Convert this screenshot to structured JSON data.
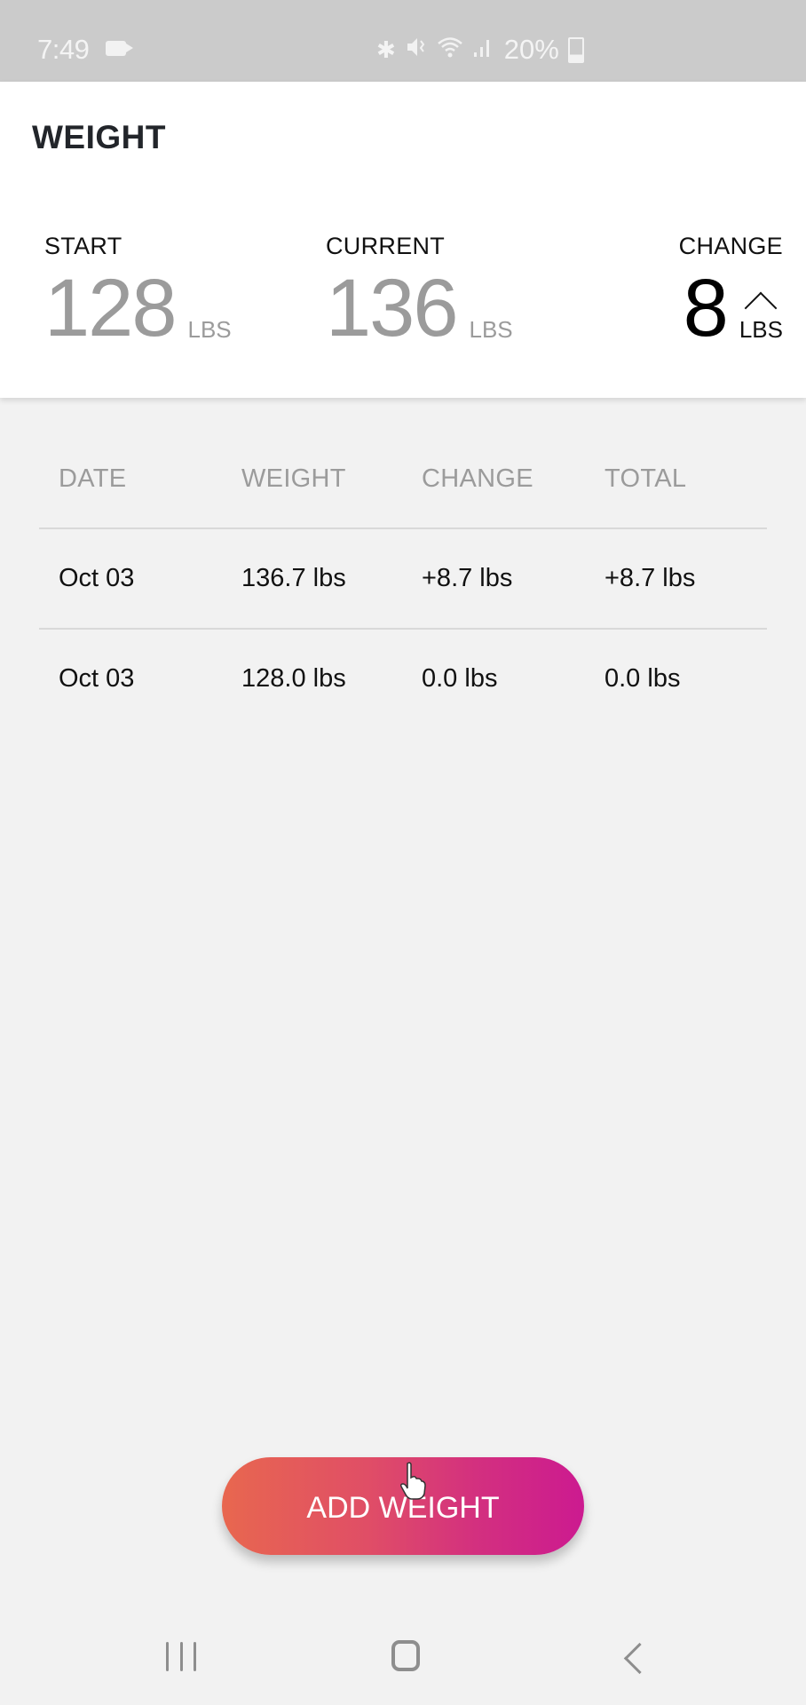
{
  "status_bar": {
    "time": "7:49",
    "battery_percent": "20%",
    "icons": [
      "video-record-icon",
      "bluetooth-icon",
      "mute-icon",
      "wifi-icon",
      "signal-icon",
      "battery-icon"
    ],
    "glyphs": {
      "bluetooth": "✱",
      "mute": "🔇︎",
      "wifi": "≋",
      "signal": ".ıl"
    }
  },
  "summary": {
    "title": "WEIGHT",
    "start": {
      "label": "START",
      "value": "128",
      "unit": "LBS"
    },
    "current": {
      "label": "CURRENT",
      "value": "136",
      "unit": "LBS"
    },
    "change": {
      "label": "CHANGE",
      "value": "8",
      "unit": "LBS",
      "direction": "up"
    }
  },
  "table": {
    "headers": [
      "DATE",
      "WEIGHT",
      "CHANGE",
      "TOTAL"
    ],
    "rows": [
      [
        "Oct 03",
        "136.7 lbs",
        "+8.7 lbs",
        "+8.7 lbs"
      ],
      [
        "Oct 03",
        "128.0 lbs",
        "0.0 lbs",
        "0.0 lbs"
      ]
    ]
  },
  "add_button": {
    "label": "ADD WEIGHT",
    "gradient_start": "#e8674f",
    "gradient_end": "#cc1a90"
  },
  "nav_bar": {
    "buttons": [
      "recent-apps",
      "home",
      "back"
    ]
  }
}
